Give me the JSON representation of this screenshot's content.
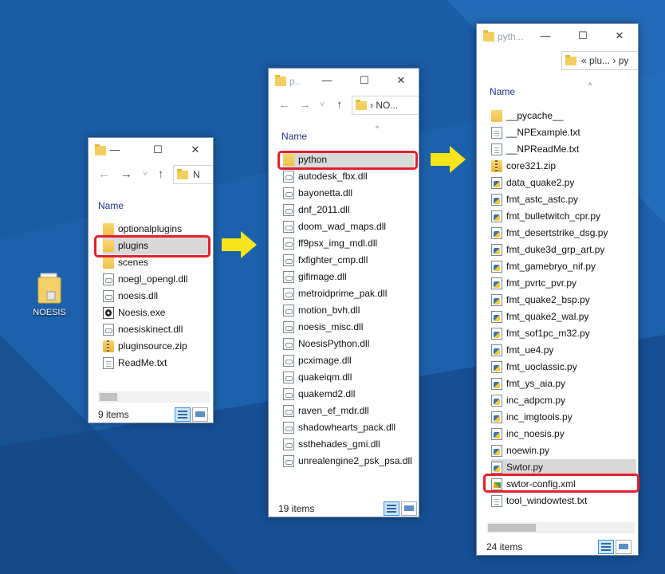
{
  "desktop": {
    "icon_label": "NOESIS",
    "wallpaper_color": "#1c5ea8"
  },
  "window1": {
    "address_text": "N",
    "column_name": "Name",
    "items": [
      {
        "name": "optionalplugins",
        "icon": "folder-icon"
      },
      {
        "name": "plugins",
        "icon": "folder-icon"
      },
      {
        "name": "scenes",
        "icon": "folder-icon"
      },
      {
        "name": "noegl_opengl.dll",
        "icon": "dll-file-icon"
      },
      {
        "name": "noesis.dll",
        "icon": "dll-file-icon"
      },
      {
        "name": "Noesis.exe",
        "icon": "exe-file-icon"
      },
      {
        "name": "noesiskinect.dll",
        "icon": "dll-file-icon"
      },
      {
        "name": "pluginsource.zip",
        "icon": "zip-file-icon"
      },
      {
        "name": "ReadMe.txt",
        "icon": "text-file-icon"
      }
    ],
    "item_count": "9 items"
  },
  "window2": {
    "title": "p..",
    "address_text": "NO...",
    "column_name": "Name",
    "items": [
      {
        "name": "python",
        "icon": "folder-icon"
      },
      {
        "name": "autodesk_fbx.dll",
        "icon": "dll-file-icon"
      },
      {
        "name": "bayonetta.dll",
        "icon": "dll-file-icon"
      },
      {
        "name": "dnf_2011.dll",
        "icon": "dll-file-icon"
      },
      {
        "name": "doom_wad_maps.dll",
        "icon": "dll-file-icon"
      },
      {
        "name": "ff9psx_img_mdl.dll",
        "icon": "dll-file-icon"
      },
      {
        "name": "fxfighter_cmp.dll",
        "icon": "dll-file-icon"
      },
      {
        "name": "gifimage.dll",
        "icon": "dll-file-icon"
      },
      {
        "name": "metroidprime_pak.dll",
        "icon": "dll-file-icon"
      },
      {
        "name": "motion_bvh.dll",
        "icon": "dll-file-icon"
      },
      {
        "name": "noesis_misc.dll",
        "icon": "dll-file-icon"
      },
      {
        "name": "NoesisPython.dll",
        "icon": "dll-file-icon"
      },
      {
        "name": "pcximage.dll",
        "icon": "dll-file-icon"
      },
      {
        "name": "quakeiqm.dll",
        "icon": "dll-file-icon"
      },
      {
        "name": "quakemd2.dll",
        "icon": "dll-file-icon"
      },
      {
        "name": "raven_ef_mdr.dll",
        "icon": "dll-file-icon"
      },
      {
        "name": "shadowhearts_pack.dll",
        "icon": "dll-file-icon"
      },
      {
        "name": "ssthehades_gmi.dll",
        "icon": "dll-file-icon"
      },
      {
        "name": "unrealengine2_psk_psa.dll",
        "icon": "dll-file-icon"
      }
    ],
    "item_count": "19 items"
  },
  "window3": {
    "title": "pyth...",
    "address_text": "« plu... › py",
    "column_name": "Name",
    "items": [
      {
        "name": "__pycache__",
        "icon": "folder-icon"
      },
      {
        "name": "__NPExample.txt",
        "icon": "text-file-icon"
      },
      {
        "name": "__NPReadMe.txt",
        "icon": "text-file-icon"
      },
      {
        "name": "core321.zip",
        "icon": "zip-file-icon"
      },
      {
        "name": "data_quake2.py",
        "icon": "python-file-icon"
      },
      {
        "name": "fmt_astc_astc.py",
        "icon": "python-file-icon"
      },
      {
        "name": "fmt_bulletwitch_cpr.py",
        "icon": "python-file-icon"
      },
      {
        "name": "fmt_desertstrike_dsg.py",
        "icon": "python-file-icon"
      },
      {
        "name": "fmt_duke3d_grp_art.py",
        "icon": "python-file-icon"
      },
      {
        "name": "fmt_gamebryo_nif.py",
        "icon": "python-file-icon"
      },
      {
        "name": "fmt_pvrtc_pvr.py",
        "icon": "python-file-icon"
      },
      {
        "name": "fmt_quake2_bsp.py",
        "icon": "python-file-icon"
      },
      {
        "name": "fmt_quake2_wal.py",
        "icon": "python-file-icon"
      },
      {
        "name": "fmt_sof1pc_m32.py",
        "icon": "python-file-icon"
      },
      {
        "name": "fmt_ue4.py",
        "icon": "python-file-icon"
      },
      {
        "name": "fmt_uoclassic.py",
        "icon": "python-file-icon"
      },
      {
        "name": "fmt_ys_aia.py",
        "icon": "python-file-icon"
      },
      {
        "name": "inc_adpcm.py",
        "icon": "python-file-icon"
      },
      {
        "name": "inc_imgtools.py",
        "icon": "python-file-icon"
      },
      {
        "name": "inc_noesis.py",
        "icon": "python-file-icon"
      },
      {
        "name": "noewin.py",
        "icon": "python-file-icon"
      },
      {
        "name": "Swtor.py",
        "icon": "python-file-icon"
      },
      {
        "name": "swtor-config.xml",
        "icon": "xml-file-icon"
      },
      {
        "name": "tool_windowtest.txt",
        "icon": "text-file-icon"
      }
    ],
    "item_count": "24 items"
  },
  "glyphs": {
    "minimize": "—",
    "maximize": "☐",
    "close": "✕",
    "back": "←",
    "forward": "→",
    "recent": "˅",
    "up": "↑",
    "sort_caret": "^"
  },
  "colors": {
    "highlight_box": "#e0222c",
    "arrow_yellow": "#f5e51a",
    "selected_row": "#d9d9d9"
  }
}
